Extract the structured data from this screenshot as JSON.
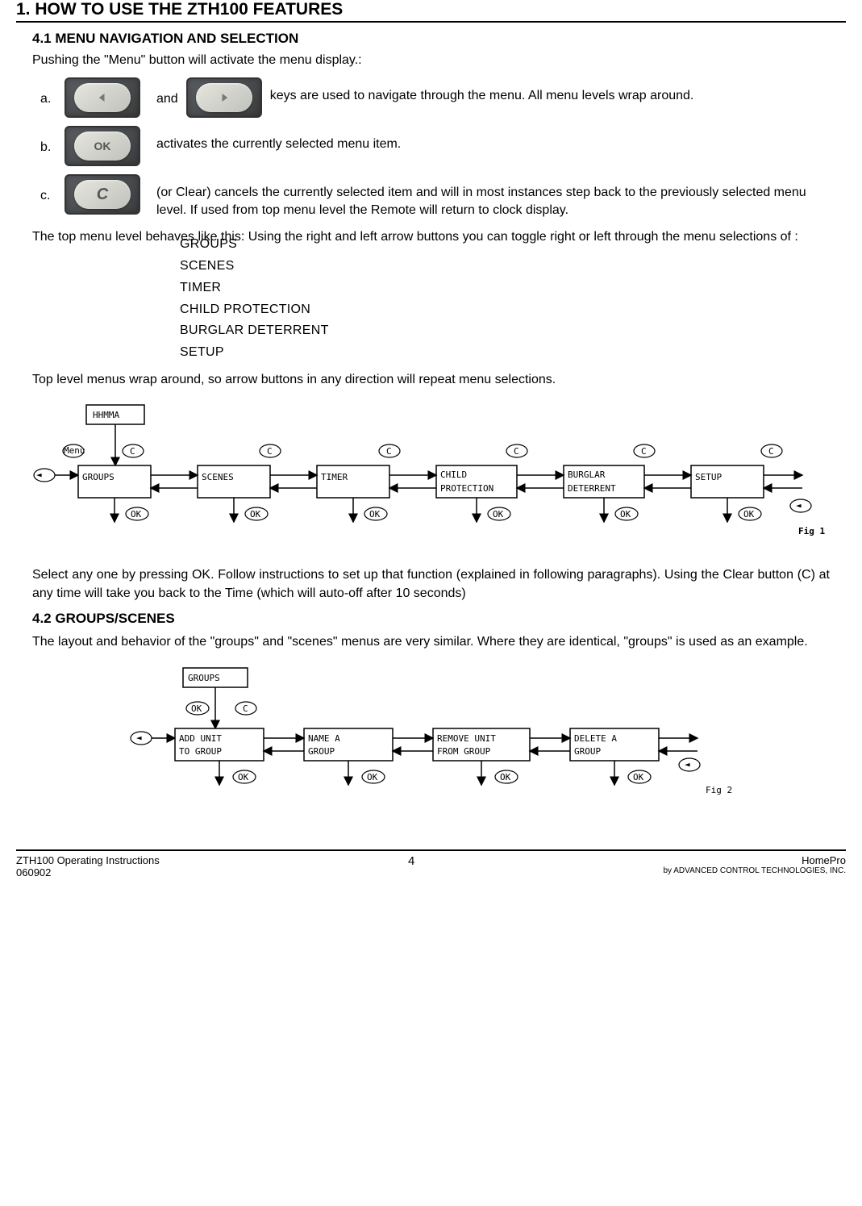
{
  "section": {
    "title": "1.  HOW TO USE THE ZTH100 FEATURES",
    "sub41": "4.1  MENU  NAVIGATION  AND  SELECTION",
    "intro": "Pushing the \"Menu\" button will activate the menu display.:",
    "a_letter": "a.",
    "and": "and",
    "a_text": "keys are used to navigate through the menu. All menu levels wrap around.",
    "b_letter": "b.",
    "b_text": "activates the currently selected menu item.",
    "c_letter": "c.",
    "c_text": "(or Clear) cancels the currently selected item and will in most instances step back to the previously selected menu level. If used from top menu level the Remote will return to clock display.",
    "top_intro": "The top menu level behaves like this:  Using the right and left arrow buttons you can toggle right or left through the menu selections of :",
    "menu_items": {
      "0": "GROUPS",
      "1": "SCENES",
      "2": "TIMER",
      "3": "CHILD   PROTECTION",
      "4": "BURGLAR   DETERRENT",
      "5": "SETUP"
    },
    "wrap_note": "Top level menus wrap around, so arrow buttons in any direction will repeat menu selections.",
    "fig1": {
      "hhmma": "HHMMA",
      "groups": "GROUPS",
      "scenes": "SCENES",
      "timer": "TIMER",
      "child1": "CHILD",
      "child2": "PROTECTION",
      "burglar1": "BURGLAR",
      "burglar2": "DETERRENT",
      "setup": "SETUP",
      "ok": "OK",
      "c": "C",
      "menu": "Menu",
      "caption": "Fig  1"
    },
    "select_para": "Select any one by pressing OK.  Follow instructions to set up that function (explained in following paragraphs).   Using the Clear button (C) at any time will take you back to the Time (which will auto-off after 10 seconds)",
    "sub42": "4.2  GROUPS/SCENES",
    "groups_intro": "The layout and behavior of the \"groups\" and \"scenes\" menus are very similar. Where they are identical, \"groups\" is used as an example.",
    "fig2": {
      "groups": "GROUPS",
      "add1": "ADD  UNIT",
      "add2": "TO  GROUP",
      "name1": "NAME  A",
      "name2": "GROUP",
      "remove1": "REMOVE  UNIT",
      "remove2": "FROM  GROUP",
      "delete1": "DELETE  A",
      "delete2": "GROUP",
      "ok": "OK",
      "c": "C",
      "caption": "Fig 2"
    }
  },
  "footer": {
    "left1": "ZTH100 Operating Instructions",
    "left2": "060902",
    "page": "4",
    "right1": "HomePro",
    "right2": "by ADVANCED CONTROL TECHNOLOGIES, INC."
  },
  "buttons": {
    "ok_label": "OK",
    "c_label": "C"
  }
}
